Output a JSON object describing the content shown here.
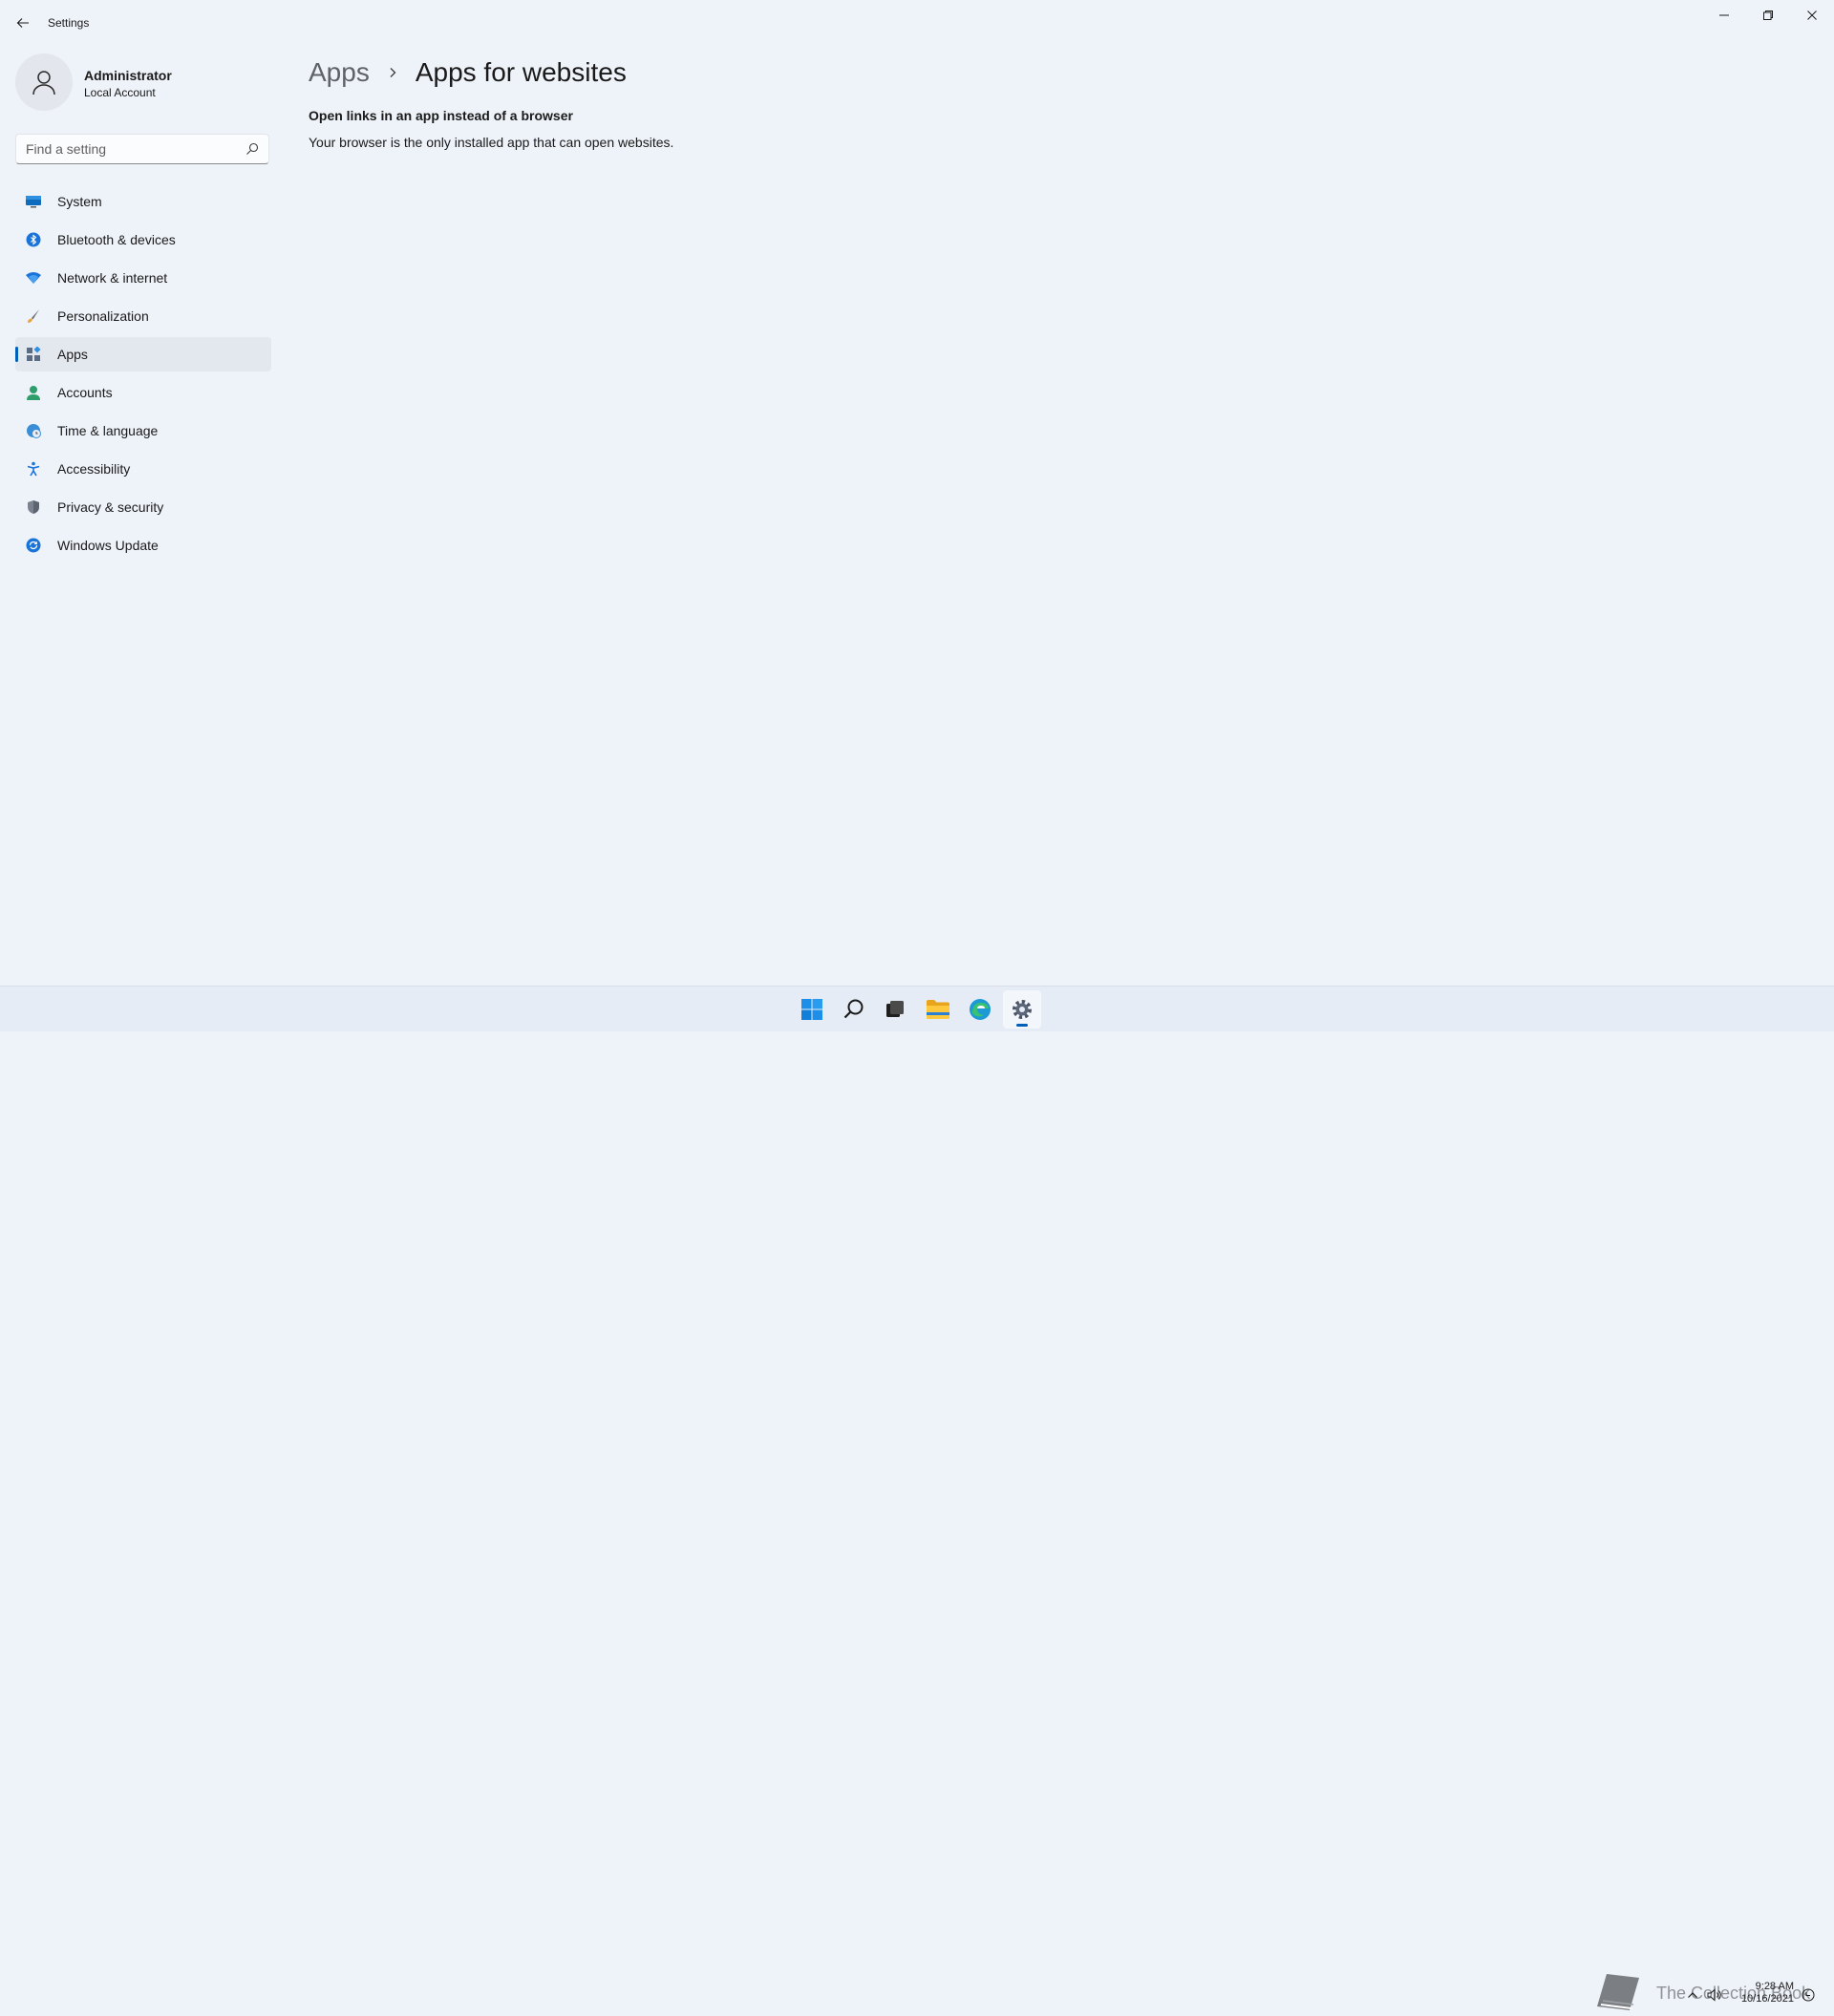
{
  "window": {
    "title": "Settings",
    "controls": [
      "minimize",
      "restore",
      "close"
    ]
  },
  "profile": {
    "name": "Administrator",
    "account_type": "Local Account"
  },
  "search": {
    "placeholder": "Find a setting",
    "value": ""
  },
  "sidebar": {
    "items": [
      {
        "label": "System",
        "icon": "monitor-icon",
        "active": false
      },
      {
        "label": "Bluetooth & devices",
        "icon": "bluetooth-icon",
        "active": false
      },
      {
        "label": "Network & internet",
        "icon": "wifi-icon",
        "active": false
      },
      {
        "label": "Personalization",
        "icon": "brush-icon",
        "active": false
      },
      {
        "label": "Apps",
        "icon": "apps-icon",
        "active": true
      },
      {
        "label": "Accounts",
        "icon": "person-icon",
        "active": false
      },
      {
        "label": "Time & language",
        "icon": "globe-clock-icon",
        "active": false
      },
      {
        "label": "Accessibility",
        "icon": "accessibility-icon",
        "active": false
      },
      {
        "label": "Privacy & security",
        "icon": "shield-icon",
        "active": false
      },
      {
        "label": "Windows Update",
        "icon": "update-icon",
        "active": false
      }
    ]
  },
  "breadcrumb": {
    "parent": "Apps",
    "current": "Apps for websites"
  },
  "content": {
    "heading": "Open links in an app instead of a browser",
    "text": "Your browser is the only installed app that can open websites."
  },
  "taskbar": {
    "apps": [
      {
        "name": "start-button",
        "icon": "windows-logo-icon"
      },
      {
        "name": "search-button",
        "icon": "search-icon"
      },
      {
        "name": "task-view-button",
        "icon": "task-view-icon"
      },
      {
        "name": "file-explorer-button",
        "icon": "folder-icon"
      },
      {
        "name": "edge-button",
        "icon": "edge-icon"
      },
      {
        "name": "settings-button",
        "icon": "gear-icon",
        "active": true
      }
    ],
    "watermark": "The Collection Book",
    "clock_time": "9:28 AM",
    "clock_date": "10/16/2021"
  },
  "colors": {
    "accent": "#005fb8",
    "background": "#eef2f9",
    "taskbar": "#e6ecf5"
  }
}
